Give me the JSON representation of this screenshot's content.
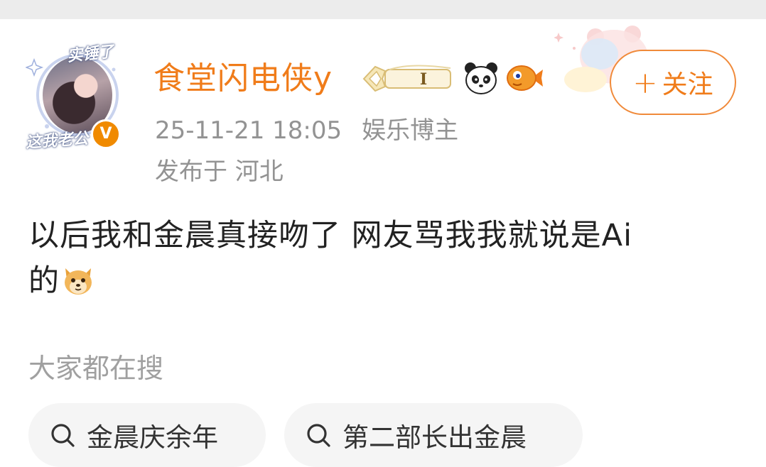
{
  "avatar": {
    "top_text": "实锤了",
    "bottom_text": "这我老公"
  },
  "user": {
    "name": "食堂闪电侠y",
    "level_badge": "I",
    "verified_mark": "V",
    "timestamp": "25-11-21 18:05",
    "role": "娱乐博主",
    "location": "发布于 河北"
  },
  "follow": {
    "plus": "+",
    "label": "关注"
  },
  "post": {
    "line1": "以后我和金晨真接吻了 网友骂我我就说是Ai",
    "line2": "的"
  },
  "search": {
    "heading": "大家都在搜",
    "chips": [
      {
        "label": "金晨庆余年"
      },
      {
        "label": "第二部长出金晨"
      }
    ]
  },
  "colors": {
    "accent": "#f07c1a",
    "meta_gray": "#939393",
    "chip_bg": "#f5f5f5",
    "verified": "#f08a00"
  },
  "icons": [
    "verified-icon",
    "level-badge-icon",
    "panda-icon",
    "fish-icon",
    "dog-emoji-icon",
    "search-icon"
  ]
}
